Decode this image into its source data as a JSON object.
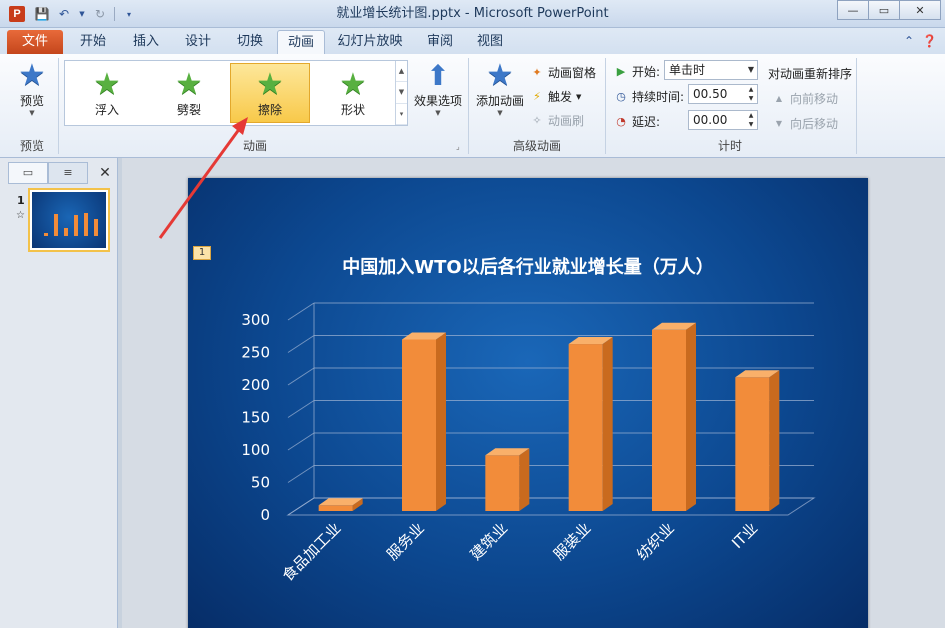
{
  "window": {
    "title": "就业增长统计图.pptx - Microsoft PowerPoint",
    "app_icon_letter": "P",
    "controls": {
      "minimize": "—",
      "maximize": "▭",
      "close": "✕"
    }
  },
  "tabs": {
    "file": "文件",
    "items": [
      "开始",
      "插入",
      "设计",
      "切换",
      "动画",
      "幻灯片放映",
      "审阅",
      "视图"
    ],
    "active": "动画"
  },
  "ribbon": {
    "preview": {
      "label": "预览",
      "group": "预览"
    },
    "animation_gallery": {
      "items": [
        "浮入",
        "劈裂",
        "擦除",
        "形状"
      ],
      "selected": "擦除",
      "group": "动画"
    },
    "effect_options": "效果选项",
    "advanced": {
      "add_animation": "添加动画",
      "animation_pane": "动画窗格",
      "trigger": "触发",
      "animation_painter": "动画刷",
      "group": "高级动画"
    },
    "timing": {
      "start_label": "开始:",
      "start_value": "单击时",
      "duration_label": "持续时间:",
      "duration_value": "00.50",
      "delay_label": "延迟:",
      "delay_value": "00.00",
      "group": "计时"
    },
    "reorder": {
      "title": "对动画重新排序",
      "move_earlier": "向前移动",
      "move_later": "向后移动"
    }
  },
  "left_pane": {
    "slide_number": "1",
    "anim_marker": "☆"
  },
  "slide": {
    "anim_tag": "1"
  },
  "chart_data": {
    "type": "bar",
    "title": "中国加入WTO以后各行业就业增长量（万人）",
    "categories": [
      "食品加工业",
      "服务业",
      "建筑业",
      "服装业",
      "纺织业",
      "IT业"
    ],
    "values": [
      15,
      270,
      92,
      263,
      285,
      212
    ],
    "ylim": [
      0,
      300
    ],
    "yticks": [
      0,
      50,
      100,
      150,
      200,
      250,
      300
    ],
    "grid": true,
    "colors": {
      "bar": "#f28c3a",
      "bar_side": "#c96a1e",
      "bar_top": "#f9b06a",
      "axis_text": "#ffffff"
    }
  }
}
